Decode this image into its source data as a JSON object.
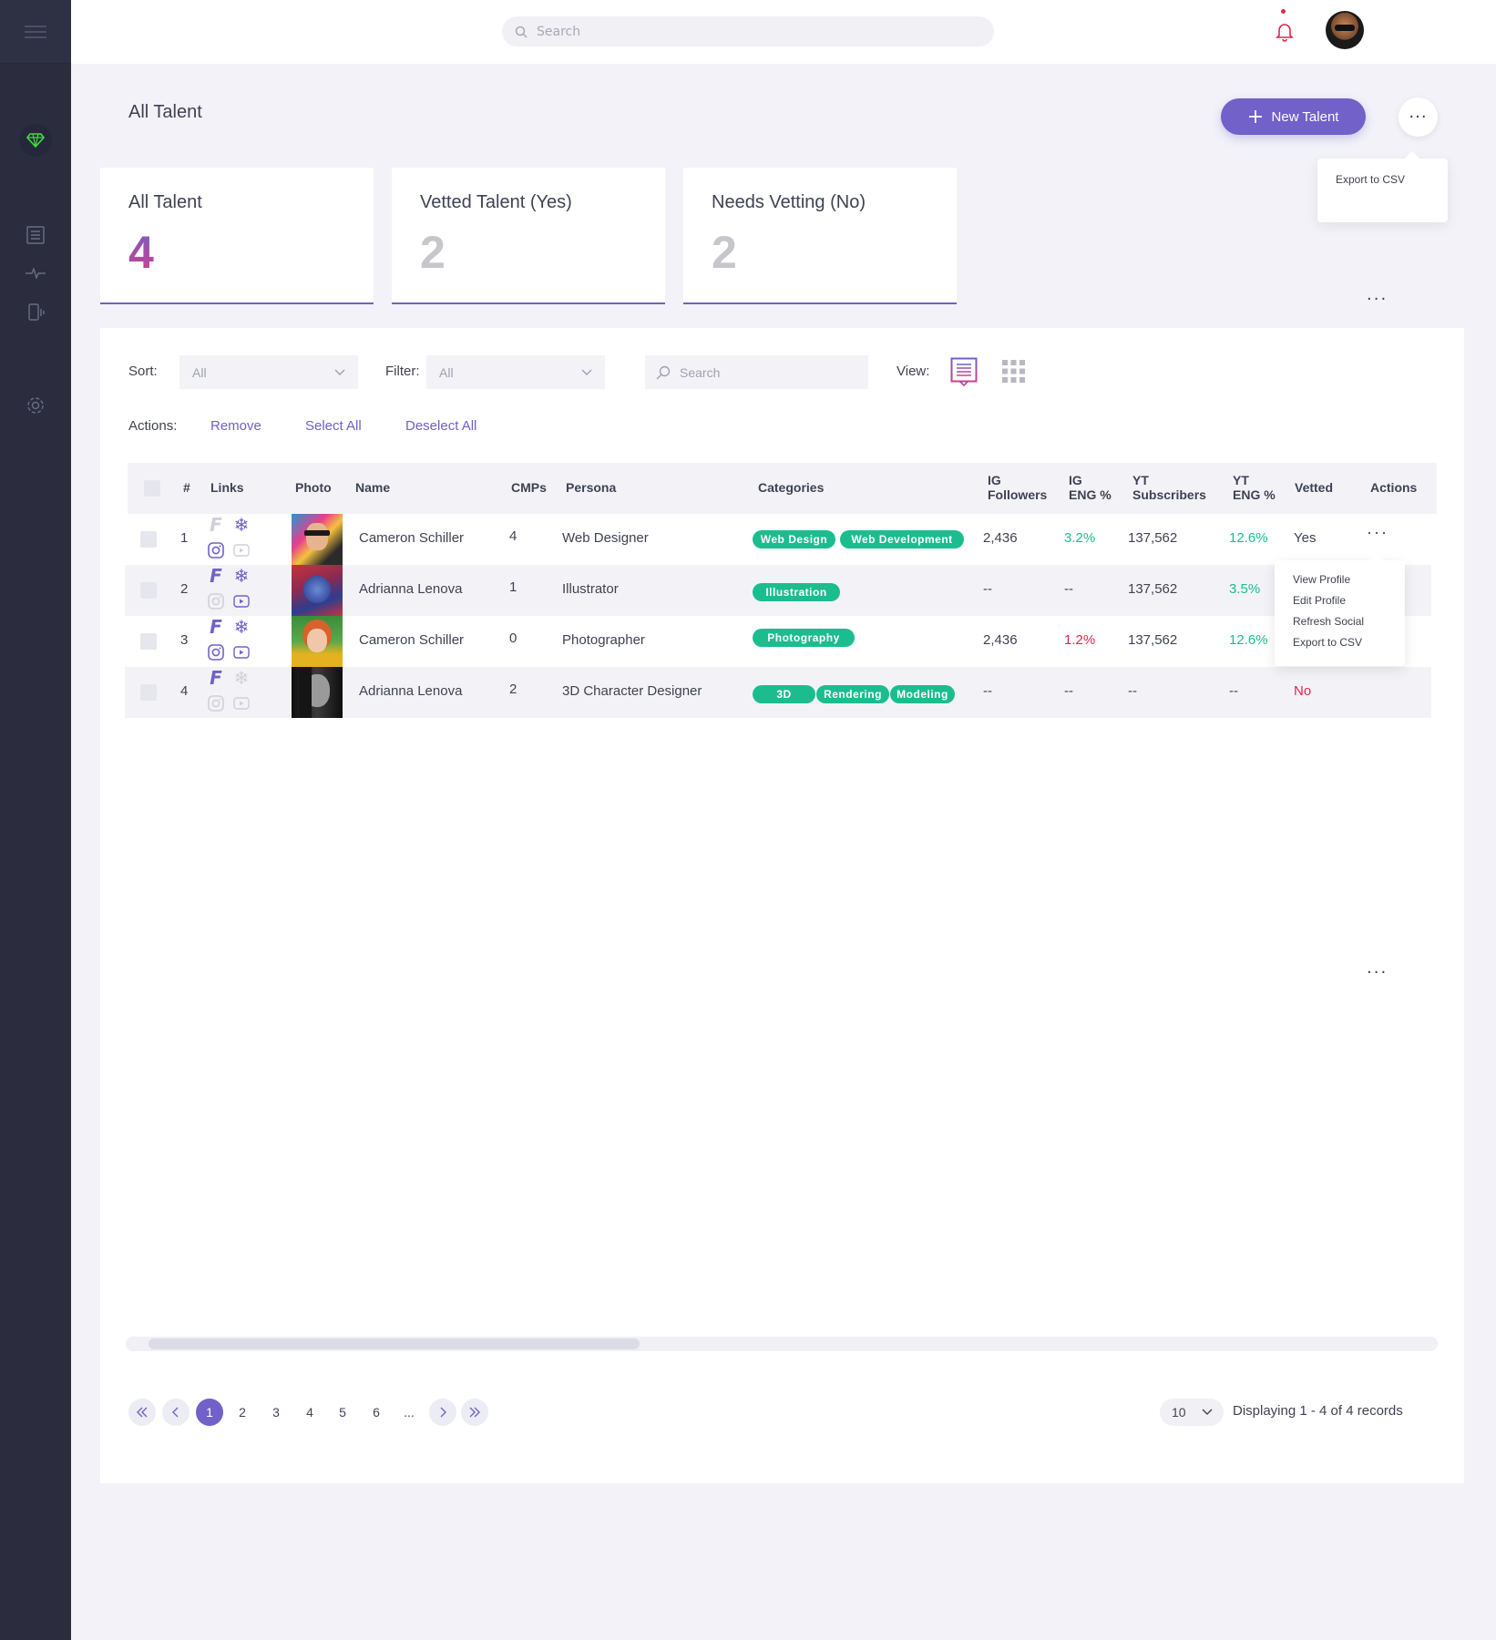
{
  "topbar": {
    "search_placeholder": "Search"
  },
  "page": {
    "title": "All Talent",
    "new_button": "New Talent",
    "export_menu_item": "Export to CSV"
  },
  "stats": [
    {
      "label": "All Talent",
      "value": "4"
    },
    {
      "label": "Vetted Talent (Yes)",
      "value": "2"
    },
    {
      "label": "Needs Vetting (No)",
      "value": "2"
    }
  ],
  "controls": {
    "sort_label": "Sort:",
    "sort_value": "All",
    "filter_label": "Filter:",
    "filter_value": "All",
    "search_placeholder": "Search",
    "view_label": "View:",
    "actions_label": "Actions:",
    "remove": "Remove",
    "select_all": "Select All",
    "deselect_all": "Deselect All"
  },
  "table": {
    "headers": {
      "num": "#",
      "links": "Links",
      "photo": "Photo",
      "name": "Name",
      "cmps": "CMPs",
      "persona": "Persona",
      "categories": "Categories",
      "ig_followers_1": "IG",
      "ig_followers_2": "Followers",
      "ig_eng_1": "IG",
      "ig_eng_2": "ENG %",
      "yt_subs_1": "YT",
      "yt_subs_2": "Subscribers",
      "yt_eng_1": "YT",
      "yt_eng_2": "ENG %",
      "vetted": "Vetted",
      "actions": "Actions"
    },
    "rows": [
      {
        "num": "1",
        "name": "Cameron Schiller",
        "cmps": "4",
        "persona": "Web Designer",
        "categories": [
          "Web Design",
          "Web Development"
        ],
        "ig_followers": "2,436",
        "ig_eng": "3.2%",
        "yt_subs": "137,562",
        "yt_eng": "12.6%",
        "vetted": "Yes"
      },
      {
        "num": "2",
        "name": "Adrianna Lenova",
        "cmps": "1",
        "persona": "Illustrator",
        "categories": [
          "Illustration"
        ],
        "ig_followers": "--",
        "ig_eng": "--",
        "yt_subs": "137,562",
        "yt_eng": "3.5%",
        "vetted": ""
      },
      {
        "num": "3",
        "name": "Cameron Schiller",
        "cmps": "0",
        "persona": "Photographer",
        "categories": [
          "Photography"
        ],
        "ig_followers": "2,436",
        "ig_eng": "1.2%",
        "yt_subs": "137,562",
        "yt_eng": "12.6%",
        "vetted": ""
      },
      {
        "num": "4",
        "name": "Adrianna Lenova",
        "cmps": "2",
        "persona": "3D Character Designer",
        "categories": [
          "3D",
          "Rendering",
          "Modeling"
        ],
        "ig_followers": "--",
        "ig_eng": "--",
        "yt_subs": "--",
        "yt_eng": "--",
        "vetted": "No"
      }
    ]
  },
  "row_menu": [
    "View Profile",
    "Edit Profile",
    "Refresh Social",
    "Export to CSV"
  ],
  "pagination": {
    "pages": [
      "1",
      "2",
      "3",
      "4",
      "5",
      "6",
      "..."
    ],
    "per_page": "10",
    "records_text": "Displaying 1 - 4 of 4 records"
  },
  "colors": {
    "accent": "#7161c8",
    "green": "#1bbd8f",
    "red": "#e2264d",
    "sidebar": "#2b2d3e"
  }
}
